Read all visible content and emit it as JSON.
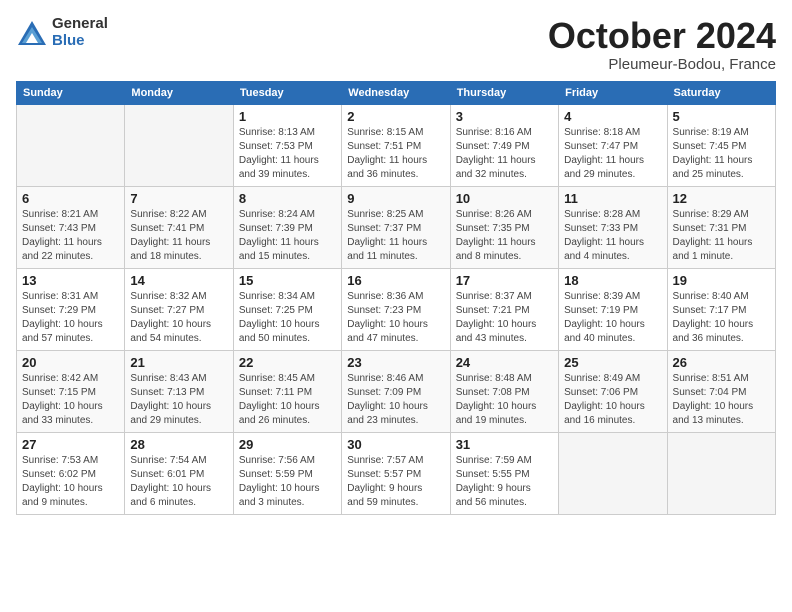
{
  "header": {
    "logo_general": "General",
    "logo_blue": "Blue",
    "month_title": "October 2024",
    "location": "Pleumeur-Bodou, France"
  },
  "days_of_week": [
    "Sunday",
    "Monday",
    "Tuesday",
    "Wednesday",
    "Thursday",
    "Friday",
    "Saturday"
  ],
  "weeks": [
    [
      {
        "day": "",
        "info": ""
      },
      {
        "day": "",
        "info": ""
      },
      {
        "day": "1",
        "info": "Sunrise: 8:13 AM\nSunset: 7:53 PM\nDaylight: 11 hours\nand 39 minutes."
      },
      {
        "day": "2",
        "info": "Sunrise: 8:15 AM\nSunset: 7:51 PM\nDaylight: 11 hours\nand 36 minutes."
      },
      {
        "day": "3",
        "info": "Sunrise: 8:16 AM\nSunset: 7:49 PM\nDaylight: 11 hours\nand 32 minutes."
      },
      {
        "day": "4",
        "info": "Sunrise: 8:18 AM\nSunset: 7:47 PM\nDaylight: 11 hours\nand 29 minutes."
      },
      {
        "day": "5",
        "info": "Sunrise: 8:19 AM\nSunset: 7:45 PM\nDaylight: 11 hours\nand 25 minutes."
      }
    ],
    [
      {
        "day": "6",
        "info": "Sunrise: 8:21 AM\nSunset: 7:43 PM\nDaylight: 11 hours\nand 22 minutes."
      },
      {
        "day": "7",
        "info": "Sunrise: 8:22 AM\nSunset: 7:41 PM\nDaylight: 11 hours\nand 18 minutes."
      },
      {
        "day": "8",
        "info": "Sunrise: 8:24 AM\nSunset: 7:39 PM\nDaylight: 11 hours\nand 15 minutes."
      },
      {
        "day": "9",
        "info": "Sunrise: 8:25 AM\nSunset: 7:37 PM\nDaylight: 11 hours\nand 11 minutes."
      },
      {
        "day": "10",
        "info": "Sunrise: 8:26 AM\nSunset: 7:35 PM\nDaylight: 11 hours\nand 8 minutes."
      },
      {
        "day": "11",
        "info": "Sunrise: 8:28 AM\nSunset: 7:33 PM\nDaylight: 11 hours\nand 4 minutes."
      },
      {
        "day": "12",
        "info": "Sunrise: 8:29 AM\nSunset: 7:31 PM\nDaylight: 11 hours\nand 1 minute."
      }
    ],
    [
      {
        "day": "13",
        "info": "Sunrise: 8:31 AM\nSunset: 7:29 PM\nDaylight: 10 hours\nand 57 minutes."
      },
      {
        "day": "14",
        "info": "Sunrise: 8:32 AM\nSunset: 7:27 PM\nDaylight: 10 hours\nand 54 minutes."
      },
      {
        "day": "15",
        "info": "Sunrise: 8:34 AM\nSunset: 7:25 PM\nDaylight: 10 hours\nand 50 minutes."
      },
      {
        "day": "16",
        "info": "Sunrise: 8:36 AM\nSunset: 7:23 PM\nDaylight: 10 hours\nand 47 minutes."
      },
      {
        "day": "17",
        "info": "Sunrise: 8:37 AM\nSunset: 7:21 PM\nDaylight: 10 hours\nand 43 minutes."
      },
      {
        "day": "18",
        "info": "Sunrise: 8:39 AM\nSunset: 7:19 PM\nDaylight: 10 hours\nand 40 minutes."
      },
      {
        "day": "19",
        "info": "Sunrise: 8:40 AM\nSunset: 7:17 PM\nDaylight: 10 hours\nand 36 minutes."
      }
    ],
    [
      {
        "day": "20",
        "info": "Sunrise: 8:42 AM\nSunset: 7:15 PM\nDaylight: 10 hours\nand 33 minutes."
      },
      {
        "day": "21",
        "info": "Sunrise: 8:43 AM\nSunset: 7:13 PM\nDaylight: 10 hours\nand 29 minutes."
      },
      {
        "day": "22",
        "info": "Sunrise: 8:45 AM\nSunset: 7:11 PM\nDaylight: 10 hours\nand 26 minutes."
      },
      {
        "day": "23",
        "info": "Sunrise: 8:46 AM\nSunset: 7:09 PM\nDaylight: 10 hours\nand 23 minutes."
      },
      {
        "day": "24",
        "info": "Sunrise: 8:48 AM\nSunset: 7:08 PM\nDaylight: 10 hours\nand 19 minutes."
      },
      {
        "day": "25",
        "info": "Sunrise: 8:49 AM\nSunset: 7:06 PM\nDaylight: 10 hours\nand 16 minutes."
      },
      {
        "day": "26",
        "info": "Sunrise: 8:51 AM\nSunset: 7:04 PM\nDaylight: 10 hours\nand 13 minutes."
      }
    ],
    [
      {
        "day": "27",
        "info": "Sunrise: 7:53 AM\nSunset: 6:02 PM\nDaylight: 10 hours\nand 9 minutes."
      },
      {
        "day": "28",
        "info": "Sunrise: 7:54 AM\nSunset: 6:01 PM\nDaylight: 10 hours\nand 6 minutes."
      },
      {
        "day": "29",
        "info": "Sunrise: 7:56 AM\nSunset: 5:59 PM\nDaylight: 10 hours\nand 3 minutes."
      },
      {
        "day": "30",
        "info": "Sunrise: 7:57 AM\nSunset: 5:57 PM\nDaylight: 9 hours\nand 59 minutes."
      },
      {
        "day": "31",
        "info": "Sunrise: 7:59 AM\nSunset: 5:55 PM\nDaylight: 9 hours\nand 56 minutes."
      },
      {
        "day": "",
        "info": ""
      },
      {
        "day": "",
        "info": ""
      }
    ]
  ]
}
